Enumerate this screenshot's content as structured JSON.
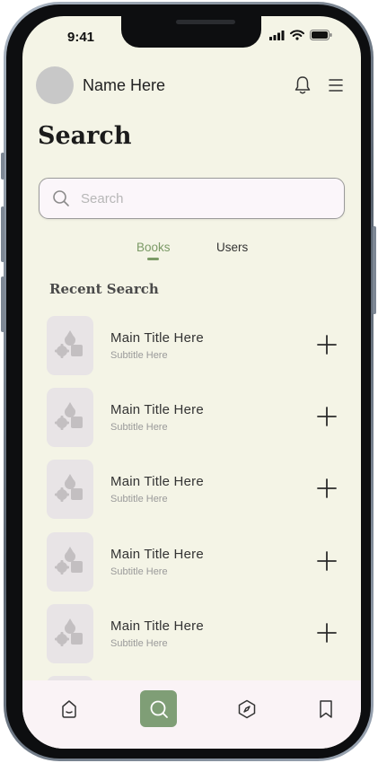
{
  "status": {
    "time": "9:41"
  },
  "header": {
    "user_name": "Name Here"
  },
  "page": {
    "title": "Search"
  },
  "search": {
    "placeholder": "Search"
  },
  "tabs": [
    {
      "label": "Books",
      "active": true
    },
    {
      "label": "Users",
      "active": false
    }
  ],
  "recent": {
    "heading": "Recent Search",
    "items": [
      {
        "title": "Main Title Here",
        "subtitle": "Subtitle Here"
      },
      {
        "title": "Main Title Here",
        "subtitle": "Subtitle Here"
      },
      {
        "title": "Main Title Here",
        "subtitle": "Subtitle Here"
      },
      {
        "title": "Main Title Here",
        "subtitle": "Subtitle Here"
      },
      {
        "title": "Main Title Here",
        "subtitle": "Subtitle Here"
      }
    ]
  },
  "nav": {
    "items": [
      {
        "icon": "home-icon",
        "active": false
      },
      {
        "icon": "search-icon",
        "active": true
      },
      {
        "icon": "compass-icon",
        "active": false
      },
      {
        "icon": "bookmark-icon",
        "active": false
      }
    ]
  },
  "colors": {
    "background": "#f4f4e6",
    "accent": "#7b9a66",
    "nav_active": "#7f9e76",
    "thumbnail": "#e8e4e6"
  }
}
